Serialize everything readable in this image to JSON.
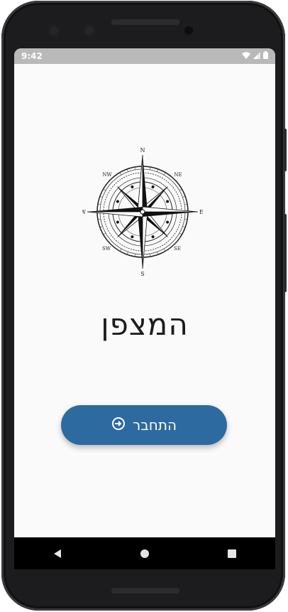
{
  "status_bar": {
    "time": "9:42",
    "icons": [
      "wifi-icon",
      "signal-icon",
      "battery-icon"
    ]
  },
  "compass": {
    "north": "N",
    "south": "S",
    "east": "E",
    "west": "W",
    "northeast": "NE",
    "northwest": "NW",
    "southeast": "SE",
    "southwest": "SW"
  },
  "app": {
    "title": "המצפן"
  },
  "login_button": {
    "label": "התחבר",
    "icon": "login-icon",
    "color": "#2d6aa0"
  },
  "nav_bar": {
    "buttons": [
      "back-icon",
      "home-icon",
      "recents-icon"
    ]
  }
}
